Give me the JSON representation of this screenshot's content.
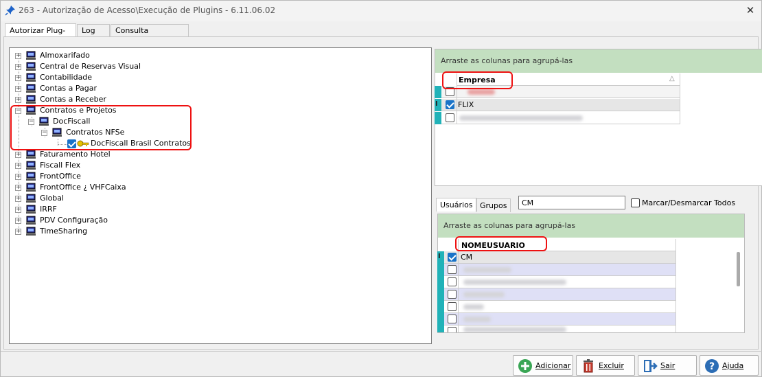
{
  "window": {
    "title": "263 - Autorização de Acesso\\Execução de Plugins - 6.11.06.02",
    "close_glyph": "✕"
  },
  "tabs": [
    {
      "label": "Autorizar Plug-ins",
      "active": true
    },
    {
      "label": "Log",
      "active": false
    },
    {
      "label": "Consulta Permissões",
      "active": false
    }
  ],
  "tree": {
    "items": [
      {
        "label": "Almoxarifado",
        "level": 0,
        "expander": "+"
      },
      {
        "label": "Central de Reservas Visual",
        "level": 0,
        "expander": "+"
      },
      {
        "label": "Contabilidade",
        "level": 0,
        "expander": "+"
      },
      {
        "label": "Contas a Pagar",
        "level": 0,
        "expander": "+"
      },
      {
        "label": "Contas a Receber",
        "level": 0,
        "expander": "+"
      },
      {
        "label": "Contratos e Projetos",
        "level": 0,
        "expander": "−"
      },
      {
        "label": "DocFiscall",
        "level": 1,
        "expander": "−"
      },
      {
        "label": "Contratos NFSe",
        "level": 2,
        "expander": "−"
      },
      {
        "label": "DocFiscall Brasil Contratos",
        "level": 3,
        "checked": true
      },
      {
        "label": "Faturamento Hotel",
        "level": 0,
        "expander": "+"
      },
      {
        "label": "Fiscall Flex",
        "level": 0,
        "expander": "+"
      },
      {
        "label": "FrontOffice",
        "level": 0,
        "expander": "+"
      },
      {
        "label": "FrontOffice ¿ VHFCaixa",
        "level": 0,
        "expander": "+"
      },
      {
        "label": "Global",
        "level": 0,
        "expander": "+"
      },
      {
        "label": "IRRF",
        "level": 0,
        "expander": "+"
      },
      {
        "label": "PDV Configuração",
        "level": 0,
        "expander": "+"
      },
      {
        "label": "TimeSharing",
        "level": 0,
        "expander": "+"
      }
    ]
  },
  "company_grid": {
    "group_hint": "Arraste as colunas para agrupá-las",
    "column_header": "Empresa",
    "sort_glyph": "△",
    "rows": [
      {
        "value": "",
        "checked": false,
        "blurred": true
      },
      {
        "value": "FLIX",
        "checked": true,
        "blurred": false
      },
      {
        "value": "",
        "checked": false,
        "blurred": true
      }
    ]
  },
  "users_panel": {
    "tab_users": "Usuários",
    "tab_groups": "Grupos",
    "search_value": "CM",
    "select_all_label": "Marcar/Desmarcar Todos",
    "group_hint": "Arraste as colunas para agrupá-las",
    "column_header": "NOMEUSUARIO",
    "rows": [
      {
        "value": "CM",
        "checked": true,
        "blurred": false
      },
      {
        "value": "",
        "checked": false,
        "blurred": true
      },
      {
        "value": "",
        "checked": false,
        "blurred": true
      },
      {
        "value": "",
        "checked": false,
        "blurred": true
      },
      {
        "value": "",
        "checked": false,
        "blurred": true
      },
      {
        "value": "",
        "checked": false,
        "blurred": true
      },
      {
        "value": "",
        "checked": false,
        "blurred": true
      }
    ]
  },
  "buttons": {
    "add": "Adicionar",
    "delete": "Excluir",
    "exit": "Sair",
    "help": "Ajuda"
  },
  "colors": {
    "group_bar": "#c3dfc0",
    "row_indicator": "#21b2b8",
    "highlight_box": "#e11111",
    "checkbox_checked": "#1a73c8"
  }
}
